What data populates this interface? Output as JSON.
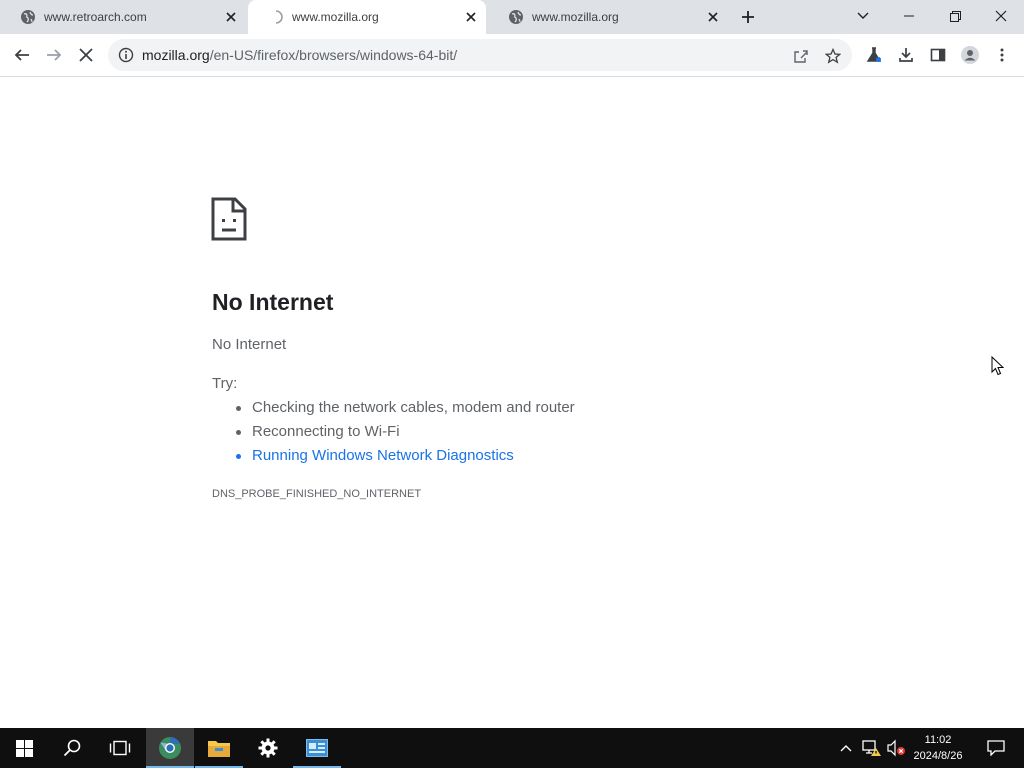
{
  "browser": {
    "tabs": [
      {
        "title": "www.retroarch.com",
        "active": false,
        "loading": false,
        "icon": "globe-icon"
      },
      {
        "title": "www.mozilla.org",
        "active": true,
        "loading": true,
        "icon": "loading-spinner-icon"
      },
      {
        "title": "www.mozilla.org",
        "active": false,
        "loading": false,
        "icon": "globe-icon"
      }
    ],
    "address_bar": {
      "host": "mozilla.org",
      "path": "/en-US/firefox/browsers/windows-64-bit/"
    }
  },
  "error_page": {
    "title": "No Internet",
    "message": "No Internet",
    "try_label": "Try:",
    "suggestions": [
      "Checking the network cables, modem and router",
      "Reconnecting to Wi-Fi",
      "Running Windows Network Diagnostics"
    ],
    "error_code": "DNS_PROBE_FINISHED_NO_INTERNET"
  },
  "taskbar": {
    "time": "11:02",
    "date": "2024/8/26"
  },
  "colors": {
    "link": "#1a73e8",
    "tabstrip": "#dee1e6",
    "taskbar": "#0f0f0f"
  }
}
